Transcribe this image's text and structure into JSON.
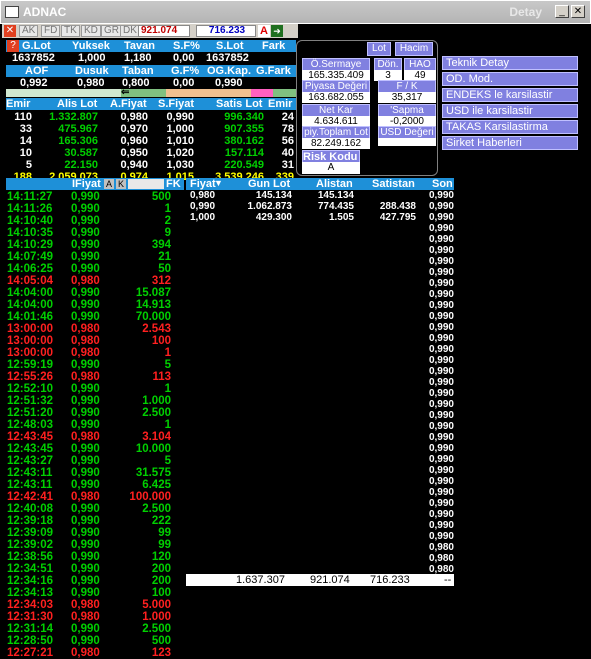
{
  "window": {
    "title": "ADNAC",
    "right_label": "Detay"
  },
  "toolbar": {
    "tabs": [
      "AK",
      "FD",
      "TK",
      "KD",
      "GR",
      "DK"
    ],
    "value1": "921.074",
    "value2": "716.233",
    "a_label": "A"
  },
  "summary": {
    "headers": [
      "G.Lot",
      "Yuksek",
      "Tavan",
      "S.F%",
      "S.Lot",
      "Fark"
    ],
    "values": [
      "1637852",
      "1,000",
      "1,180",
      "0,00",
      "1637852",
      ""
    ],
    "headers2": [
      "AOF",
      "Dusuk",
      "Taban",
      "G.F%",
      "OG.Kap.",
      "G.Fark"
    ],
    "values2": [
      "0,992",
      "0,980",
      "0,800",
      "0,00",
      "0,990",
      ""
    ]
  },
  "depth": {
    "headers": [
      "Emir",
      "Alis Lot",
      "A.Fiyat",
      "S.Fiyat",
      "Satis Lot",
      "Emir"
    ],
    "rows": [
      [
        "110",
        "1.332.807",
        "0,980",
        "0,990",
        "996.340",
        "24"
      ],
      [
        "33",
        "475.967",
        "0,970",
        "1,000",
        "907.355",
        "78"
      ],
      [
        "14",
        "165.306",
        "0,960",
        "1,010",
        "380.162",
        "56"
      ],
      [
        "10",
        "30.587",
        "0,950",
        "1,020",
        "157.114",
        "40"
      ],
      [
        "5",
        "22.150",
        "0,940",
        "1,030",
        "220.549",
        "31"
      ],
      [
        "188",
        "2.059.073",
        "0,974",
        "1,015",
        "3.539.246",
        "339"
      ]
    ]
  },
  "info": {
    "lot_btn": "Lot",
    "hacim_btn": "Hacim",
    "osermaye_label": "Ö.Sermaye",
    "osermaye": "165.335.409",
    "don_label": "Dön.",
    "don": "3",
    "hao_label": "HAO",
    "hao": "49",
    "piyasa_label": "Piyasa Değeri",
    "piyasa": "163.682.055",
    "fk_label": "F / K",
    "fk": "35,317",
    "netkar_label": "Net Kar",
    "netkar": "4.634.611",
    "sapma_label": "'Sapma",
    "sapma": "-0,2000",
    "toplam_label": "piy.Toplam Lot",
    "toplam": "82.249.162",
    "usd_label": "USD Değeri",
    "usd": "",
    "risk_label": "Risk Kodu",
    "risk": "A"
  },
  "menu": [
    "Teknik Detay",
    "OD. Mod.",
    "ENDEKS le karsilastir",
    "USD ile karsilastir",
    "TAKAS Karsilastirma",
    "Sirket Haberleri"
  ],
  "trades_header": {
    "fiyat": "IFiyat",
    "a": "A",
    "k": "K",
    "fk": "FK"
  },
  "trades": [
    [
      "14:11:27",
      "0,990",
      "500",
      "g"
    ],
    [
      "14:11:26",
      "0,990",
      "1",
      "g"
    ],
    [
      "14:10:40",
      "0,990",
      "2",
      "g"
    ],
    [
      "14:10:35",
      "0,990",
      "9",
      "g"
    ],
    [
      "14:10:29",
      "0,990",
      "394",
      "g"
    ],
    [
      "14:07:49",
      "0,990",
      "21",
      "g"
    ],
    [
      "14:06:25",
      "0,990",
      "50",
      "g"
    ],
    [
      "14:05:04",
      "0,980",
      "312",
      "r"
    ],
    [
      "14:04:00",
      "0,990",
      "15.087",
      "g"
    ],
    [
      "14:04:00",
      "0,990",
      "14.913",
      "g"
    ],
    [
      "14:01:46",
      "0,990",
      "70.000",
      "g"
    ],
    [
      "13:00:00",
      "0,980",
      "2.543",
      "r"
    ],
    [
      "13:00:00",
      "0,980",
      "100",
      "r"
    ],
    [
      "13:00:00",
      "0,980",
      "1",
      "r"
    ],
    [
      "12:59:19",
      "0,990",
      "5",
      "g"
    ],
    [
      "12:55:26",
      "0,980",
      "113",
      "r"
    ],
    [
      "12:52:10",
      "0,990",
      "1",
      "g"
    ],
    [
      "12:51:32",
      "0,990",
      "1.000",
      "g"
    ],
    [
      "12:51:20",
      "0,990",
      "2.500",
      "g"
    ],
    [
      "12:48:03",
      "0,990",
      "1",
      "g"
    ],
    [
      "12:43:45",
      "0,980",
      "3.104",
      "r"
    ],
    [
      "12:43:45",
      "0,990",
      "10.000",
      "g"
    ],
    [
      "12:43:27",
      "0,990",
      "5",
      "g"
    ],
    [
      "12:43:11",
      "0,990",
      "31.575",
      "g"
    ],
    [
      "12:43:11",
      "0,990",
      "6.425",
      "g"
    ],
    [
      "12:42:41",
      "0,980",
      "100.000",
      "r"
    ],
    [
      "12:40:08",
      "0,990",
      "2.500",
      "g"
    ],
    [
      "12:39:18",
      "0,990",
      "222",
      "g"
    ],
    [
      "12:39:09",
      "0,990",
      "99",
      "g"
    ],
    [
      "12:39:02",
      "0,990",
      "99",
      "g"
    ],
    [
      "12:38:56",
      "0,990",
      "120",
      "g"
    ],
    [
      "12:34:51",
      "0,990",
      "200",
      "g"
    ],
    [
      "12:34:16",
      "0,990",
      "200",
      "g"
    ],
    [
      "12:34:13",
      "0,990",
      "100",
      "g"
    ],
    [
      "12:34:03",
      "0,980",
      "5.000",
      "r"
    ],
    [
      "12:31:30",
      "0,980",
      "1.000",
      "r"
    ],
    [
      "12:31:14",
      "0,990",
      "2.500",
      "g"
    ],
    [
      "12:28:50",
      "0,990",
      "500",
      "g"
    ],
    [
      "12:27:21",
      "0,980",
      "123",
      "r"
    ]
  ],
  "pricetable": {
    "headers": [
      "Fiyat",
      "Gun Lot",
      "Alistan",
      "Satistan",
      "Son"
    ],
    "rows": [
      [
        "0,980",
        "145.134",
        "145.134",
        "",
        ""
      ],
      [
        "0,990",
        "1.062.873",
        "774.435",
        "288.438",
        ""
      ],
      [
        "1,000",
        "429.300",
        "1.505",
        "427.795",
        ""
      ]
    ],
    "totals": [
      "1.637.307",
      "921.074",
      "716.233",
      "--"
    ]
  },
  "son": [
    "0,990",
    "0,990",
    "0,990",
    "0,990",
    "0,990",
    "0,990",
    "0,990",
    "0,990",
    "0,990",
    "0,990",
    "0,990",
    "0,990",
    "0,990",
    "0,990",
    "0,990",
    "0,990",
    "0,990",
    "0,990",
    "0,990",
    "0,990",
    "0,990",
    "0,990",
    "0,990",
    "0,990",
    "0,990",
    "0,990",
    "0,990",
    "0,990",
    "0,990",
    "0,990",
    "0,990",
    "0,990",
    "0,980",
    "0,980",
    "0,980",
    "0,980",
    "0,980"
  ]
}
